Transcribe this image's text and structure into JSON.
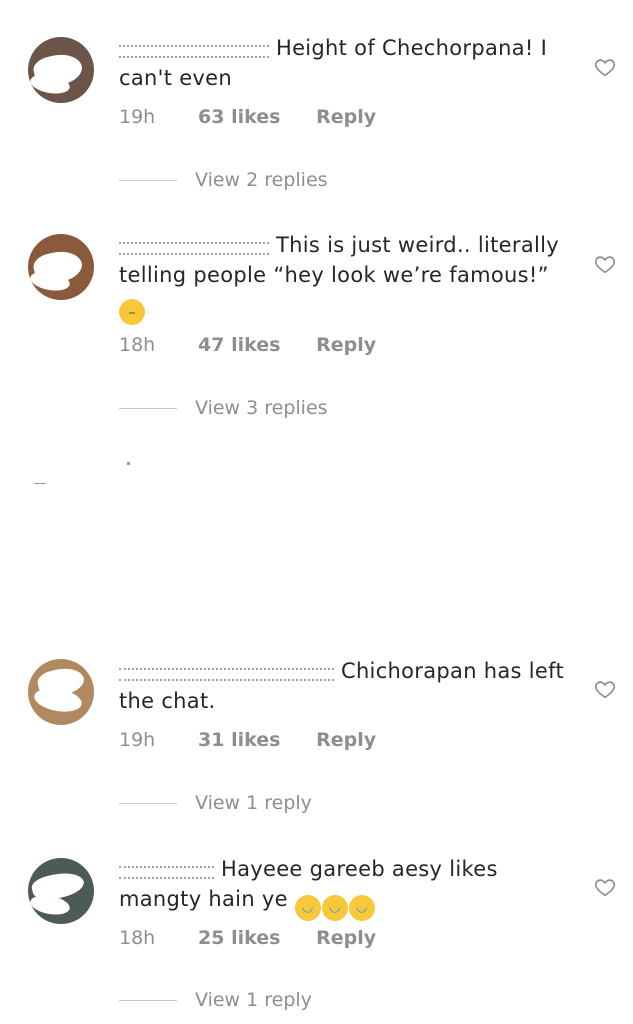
{
  "comments": [
    {
      "username_visible": "Icihe....",
      "text": "Height of Chechorpana! I can't even",
      "time": "19h",
      "likes": "63 likes",
      "reply_label": "Reply",
      "view_replies": "View 2 replies"
    },
    {
      "username_visible": "fa.....noor..",
      "text": "This is just weird.. literally telling people “hey look we’re famous!”",
      "emoji": "neutral-face-emoji",
      "time": "18h",
      "likes": "47 likes",
      "reply_label": "Reply",
      "view_replies": "View 3 replies"
    },
    {
      "username_visible": "ia..........m",
      "text": "Chichorapan has left the chat.",
      "time": "19h",
      "likes": "31 likes",
      "reply_label": "Reply",
      "view_replies": "View 1 reply"
    },
    {
      "username_visible": "iz.....a",
      "text": "Hayeee gareeb aesy likes mangty hain ye",
      "emoji": "face-with-tears-of-joy-emoji x3",
      "time": "18h",
      "likes": "25 likes",
      "reply_label": "Reply",
      "view_replies": "View 1 reply"
    }
  ],
  "icons": {
    "like": "heart-outline-icon",
    "avatar": "profile-avatar-icon"
  },
  "colors": {
    "text": "#262626",
    "meta": "#8e8e8e",
    "divider": "#c7c7c7"
  }
}
